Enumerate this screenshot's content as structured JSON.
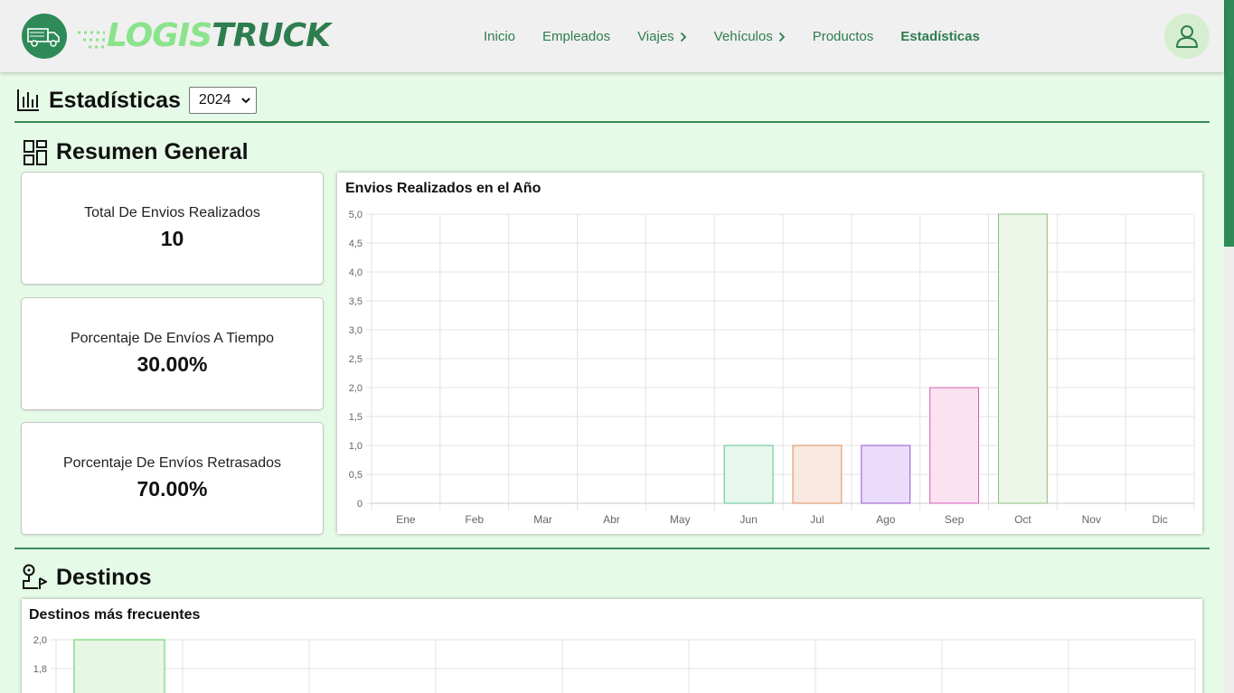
{
  "brand": {
    "name_part1": "LOGIS",
    "name_part2": "TRUCK"
  },
  "nav": [
    {
      "label": "Inicio",
      "has_chevron": false,
      "active": false
    },
    {
      "label": "Empleados",
      "has_chevron": false,
      "active": false
    },
    {
      "label": "Viajes",
      "has_chevron": true,
      "active": false
    },
    {
      "label": "Vehículos",
      "has_chevron": true,
      "active": false
    },
    {
      "label": "Productos",
      "has_chevron": false,
      "active": false
    },
    {
      "label": "Estadísticas",
      "has_chevron": false,
      "active": true
    }
  ],
  "page": {
    "title": "Estadísticas",
    "year": "2024"
  },
  "summary": {
    "title": "Resumen General",
    "cards": [
      {
        "label": "Total De Envios Realizados",
        "value": "10"
      },
      {
        "label": "Porcentaje De Envíos A Tiempo",
        "value": "30.00%"
      },
      {
        "label": "Porcentaje De Envíos Retrasados",
        "value": "70.00%"
      }
    ]
  },
  "destinations": {
    "title": "Destinos"
  },
  "colors": {
    "accent": "#2e8b57",
    "background": "#e6fbe7"
  },
  "chart_data": [
    {
      "type": "bar",
      "title": "Envios Realizados en el Año",
      "categories": [
        "Ene",
        "Feb",
        "Mar",
        "Abr",
        "May",
        "Jun",
        "Jul",
        "Ago",
        "Sep",
        "Oct",
        "Nov",
        "Dic"
      ],
      "values": [
        0,
        0,
        0,
        0,
        0,
        1,
        1,
        1,
        2,
        5,
        0,
        0
      ],
      "ylim": [
        0,
        5
      ],
      "yticks": [
        "0",
        "0,5",
        "1,0",
        "1,5",
        "2,0",
        "2,5",
        "3,0",
        "3,5",
        "4,0",
        "4,5",
        "5,0"
      ],
      "bar_fills": [
        "#ffffff",
        "#ffffff",
        "#ffffff",
        "#ffffff",
        "#ffffff",
        "#e6f7ee",
        "#f8e8df",
        "#eadcfa",
        "#fbe2f1",
        "#edf5e9",
        "#ffffff",
        "#ffffff"
      ],
      "bar_strokes": [
        "#cccccc",
        "#cccccc",
        "#cccccc",
        "#cccccc",
        "#cccccc",
        "#5cc08e",
        "#e08c59",
        "#9654d6",
        "#d65cb5",
        "#8cc17b",
        "#cccccc",
        "#cccccc"
      ],
      "grid": true
    },
    {
      "type": "bar",
      "title": "Destinos más frecuentes",
      "categories": [],
      "values": [
        2
      ],
      "visible_yticks": [
        "2,0",
        "1,8"
      ],
      "bar_fills": [
        "#e6f7e3"
      ],
      "bar_strokes": [
        "#5ccd5c"
      ],
      "grid": true
    }
  ]
}
